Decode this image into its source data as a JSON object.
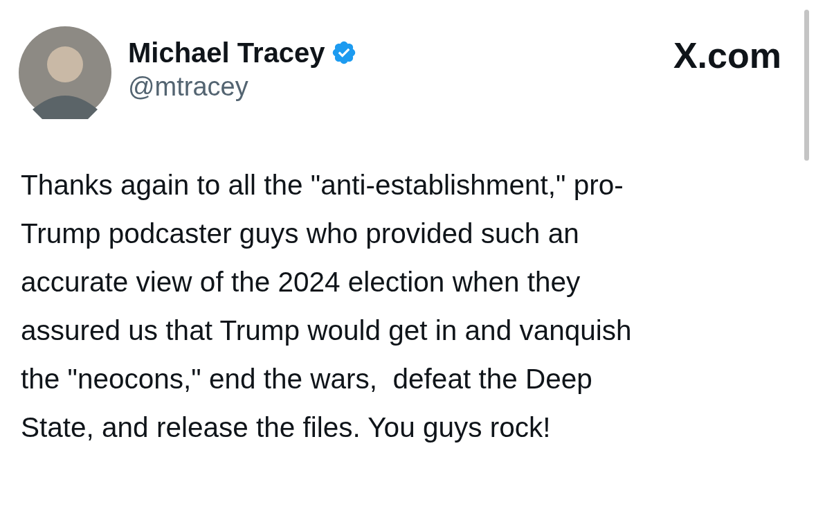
{
  "author": {
    "name": "Michael Tracey",
    "handle": "@mtracey",
    "verified": true
  },
  "site": "X.com",
  "tweet": {
    "lines": [
      "Thanks again to all the \"anti-establishment,\" pro-",
      "Trump podcaster guys who provided such an",
      "accurate view of the 2024 election when they",
      "assured us that Trump would get in and vanquish",
      "the \"neocons,\" end the wars,  defeat the Deep",
      "State, and release the files. You guys rock!"
    ]
  }
}
